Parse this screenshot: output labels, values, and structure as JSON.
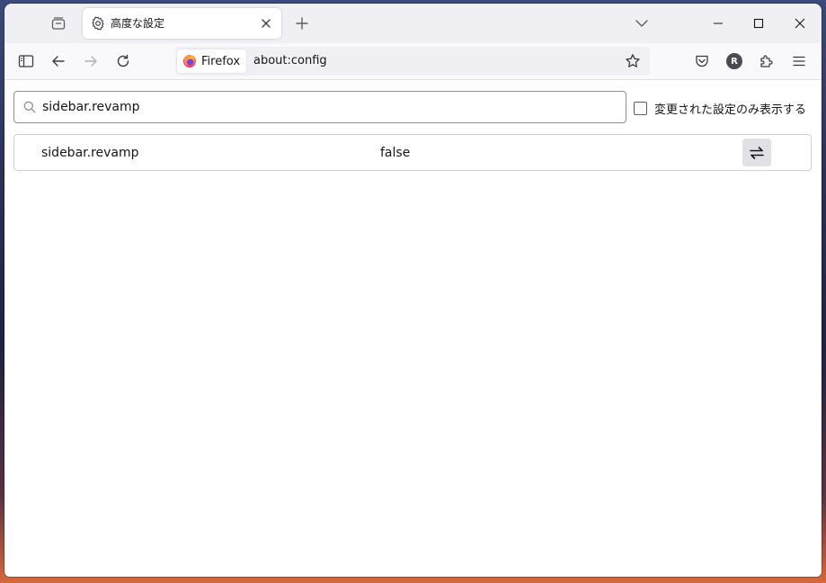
{
  "tab": {
    "title": "高度な設定"
  },
  "urlbar": {
    "identity_label": "Firefox",
    "url": "about:config"
  },
  "toolbar": {
    "account_initial": "R"
  },
  "search": {
    "value": "sidebar.revamp"
  },
  "filter": {
    "label": "変更された設定のみ表示する",
    "checked": false
  },
  "preferences": [
    {
      "name": "sidebar.revamp",
      "value": "false"
    }
  ],
  "colors": {
    "accent": "#0061e0",
    "tabstrip": "#f0f0f4",
    "navbar": "#f9f9fb"
  },
  "icons": {
    "tab": "gear-icon",
    "toggle": "toggle-arrows-icon",
    "search": "search-icon"
  }
}
